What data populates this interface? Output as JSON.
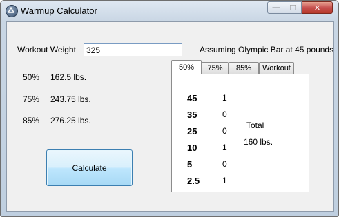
{
  "window": {
    "title": "Warmup Calculator",
    "minimize_glyph": "—",
    "maximize_glyph": "☐",
    "close_glyph": "✕"
  },
  "form": {
    "weight_label": "Workout Weight",
    "weight_value": "325",
    "bar_note": "Assuming Olympic Bar at 45 pounds",
    "calculate_label": "Calculate"
  },
  "percentages": [
    {
      "percent": "50%",
      "weight": "162.5 lbs."
    },
    {
      "percent": "75%",
      "weight": "243.75 lbs."
    },
    {
      "percent": "85%",
      "weight": "276.25 lbs."
    }
  ],
  "tabs": [
    "50%",
    "75%",
    "85%",
    "Workout"
  ],
  "active_tab": 0,
  "plates": [
    {
      "plate": "45",
      "count": "1"
    },
    {
      "plate": "35",
      "count": "0"
    },
    {
      "plate": "25",
      "count": "0"
    },
    {
      "plate": "10",
      "count": "1"
    },
    {
      "plate": "5",
      "count": "0"
    },
    {
      "plate": "2.5",
      "count": "1"
    }
  ],
  "total": {
    "label": "Total",
    "value": "160 lbs."
  }
}
